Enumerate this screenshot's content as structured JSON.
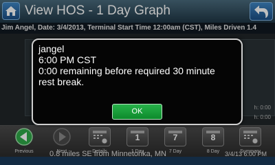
{
  "header": {
    "title": "View HOS - 1 Day Graph"
  },
  "info_line": "Jim Angel, Date:  3/4/2013, Terminal Start Time 12:00am (CST), Miles Driven 1.4",
  "background_notes": [
    "h: 0:00",
    "h: 0:00"
  ],
  "toolbar": {
    "items": [
      {
        "label": "Previous",
        "icon": "arrow-left-icon"
      },
      {
        "label": "Next",
        "icon": "arrow-right-icon"
      },
      {
        "label": "Details",
        "icon": "details-icon"
      },
      {
        "label": "1 Day",
        "icon": "calendar-icon",
        "number": "1"
      },
      {
        "label": "7 Day",
        "icon": "calendar-icon",
        "number": "7"
      },
      {
        "label": "8 Day",
        "icon": "calendar-icon",
        "number": "8"
      },
      {
        "label": "Summary",
        "icon": "summary-icon"
      }
    ]
  },
  "status": {
    "location": "0.8 miles SE from Minnetonka, MN",
    "datetime": "3/4/13 6:00 PM"
  },
  "dialog": {
    "user": "jangel",
    "time": "6:00 PM CST",
    "message_line1": "0:00 remaining before required 30 minute",
    "message_line2": "rest break.",
    "ok_label": "OK"
  },
  "colors": {
    "title_bar": "#2e4b5c",
    "ok_button": "#1aa03a",
    "status_bar": "#1a3a5a"
  }
}
